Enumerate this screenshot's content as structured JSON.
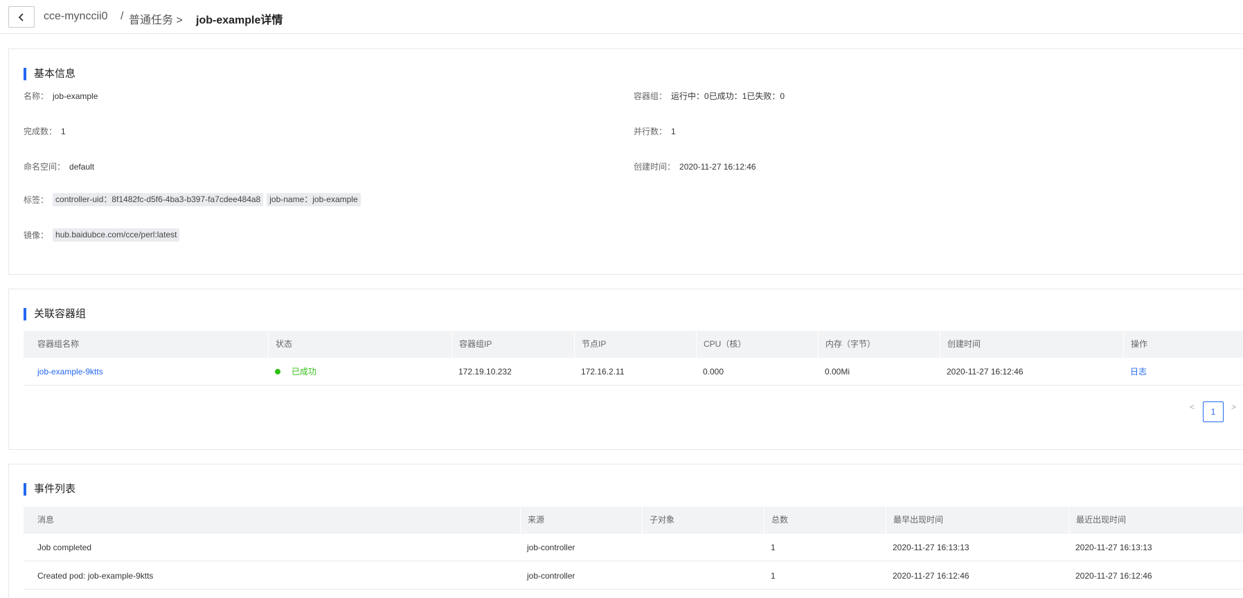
{
  "header": {
    "cluster": "cce-mynccii0",
    "separator": "/",
    "parent": "普通任务 >",
    "title": "job-example详情"
  },
  "basic": {
    "title": "基本信息",
    "name_label": "名称：",
    "name_value": "job-example",
    "pods_label": "容器组：",
    "pods_value": "运行中：0已成功：1已失败：0",
    "completions_label": "完成数：",
    "completions_value": "1",
    "parallelism_label": "并行数：",
    "parallelism_value": "1",
    "namespace_label": "命名空间：",
    "namespace_value": "default",
    "created_label": "创建时间：",
    "created_value": "2020-11-27 16:12:46",
    "labels_label": "标签：",
    "labels": [
      "controller-uid：8f1482fc-d5f6-4ba3-b397-fa7cdee484a8",
      "job-name：job-example"
    ],
    "image_label": "镜像：",
    "image_value": "hub.baidubce.com/cce/perl:latest"
  },
  "pods": {
    "title": "关联容器组",
    "columns": [
      "容器组名称",
      "状态",
      "容器组IP",
      "节点IP",
      "CPU（核）",
      "内存（字节）",
      "创建时间",
      "操作"
    ],
    "rows": [
      {
        "name": "job-example-9ktts",
        "status": "已成功",
        "pod_ip": "172.19.10.232",
        "node_ip": "172.16.2.11",
        "cpu": "0.000",
        "memory": "0.00Mi",
        "created": "2020-11-27 16:12:46",
        "action": "日志"
      }
    ],
    "pager": {
      "prev": "<",
      "page": "1",
      "next": ">"
    }
  },
  "events": {
    "title": "事件列表",
    "columns": [
      "消息",
      "来源",
      "子对象",
      "总数",
      "最早出现时间",
      "最近出现时间"
    ],
    "rows": [
      {
        "message": "Job completed",
        "source": "job-controller",
        "sub": "",
        "count": "1",
        "first": "2020-11-27 16:13:13",
        "last": "2020-11-27 16:13:13"
      },
      {
        "message": "Created pod: job-example-9ktts",
        "source": "job-controller",
        "sub": "",
        "count": "1",
        "first": "2020-11-27 16:12:46",
        "last": "2020-11-27 16:12:46"
      }
    ]
  },
  "colors": {
    "accent": "#2468f2",
    "success": "#30bf13",
    "header_bg": "#f2f3f5"
  },
  "icons": {
    "back": "chevron-left-icon",
    "status": "status-dot-icon"
  }
}
